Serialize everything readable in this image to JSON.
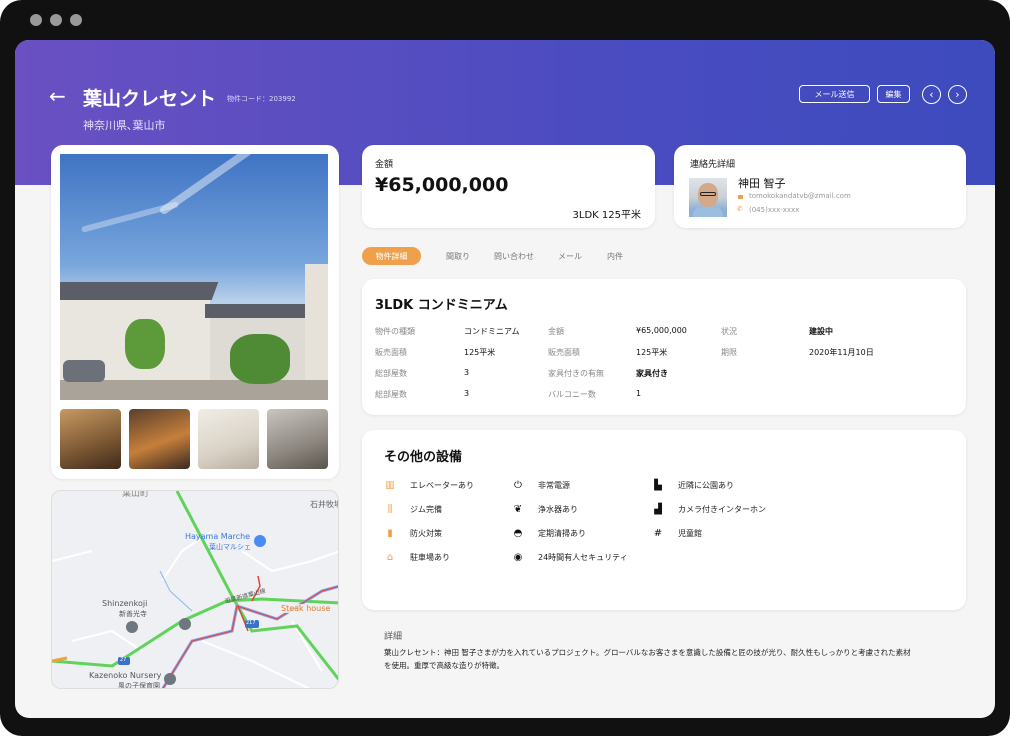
{
  "header": {
    "title": "葉山クレセント",
    "code": "物件コード：203992",
    "location": "神奈川県､葉山市",
    "mail_button": "メール送信",
    "edit_button": "編集"
  },
  "price_card": {
    "label": "金額",
    "price": "¥65,000,000",
    "summary": "3LDK 125平米"
  },
  "contact": {
    "label": "連絡先詳細",
    "name": "神田 智子",
    "email": "tomokokandatvb@zmail.com",
    "phone": "(045)xxx-xxxx"
  },
  "tabs": [
    {
      "label": "物件詳細",
      "active": true
    },
    {
      "label": "間取り"
    },
    {
      "label": "問い合わせ"
    },
    {
      "label": "メール"
    },
    {
      "label": "内件"
    }
  ],
  "details": {
    "title": "3LDK コンドミニアム",
    "rows": [
      [
        {
          "k": "物件の種類",
          "v": "コンドミニアム"
        },
        {
          "k": "金額",
          "v": "¥65,000,000"
        },
        {
          "k": "状況",
          "v": "建設中"
        }
      ],
      [
        {
          "k": "販売面積",
          "v": "125平米"
        },
        {
          "k": "販売面積",
          "v": "125平米"
        },
        {
          "k": "期限",
          "v": "2020年11月10日"
        }
      ],
      [
        {
          "k": "総部屋数",
          "v": "3"
        },
        {
          "k": "家具付きの有無",
          "v": "家具付き"
        }
      ],
      [
        {
          "k": "総部屋数",
          "v": "3"
        },
        {
          "k": "バルコニー数",
          "v": "1"
        }
      ]
    ]
  },
  "facilities": {
    "title": "その他の設備",
    "items": [
      {
        "label": "エレベーターあり",
        "icon": "elevator-icon",
        "color": "#f0a04b"
      },
      {
        "label": "非常電源",
        "icon": "plug-icon",
        "color": "#111111"
      },
      {
        "label": "近隣に公園あり",
        "icon": "park-bench-icon",
        "color": "#111111"
      },
      {
        "label": "ジム完備",
        "icon": "dumbbell-icon",
        "color": "#f0a04b"
      },
      {
        "label": "浄水器あり",
        "icon": "plant-icon",
        "color": "#111111"
      },
      {
        "label": "カメラ付きインターホン",
        "icon": "signal-icon",
        "color": "#111111"
      },
      {
        "label": "防火対策",
        "icon": "fire-extinguisher-icon",
        "color": "#f0a04b"
      },
      {
        "label": "定期清掃あり",
        "icon": "cleaning-bell-icon",
        "color": "#111111"
      },
      {
        "label": "児童館",
        "icon": "fence-icon",
        "color": "#111111"
      },
      {
        "label": "駐車場あり",
        "icon": "garage-icon",
        "color": "#f0a04b"
      },
      {
        "label": "24時間有人セキュリティ",
        "icon": "security-camera-icon",
        "color": "#111111"
      }
    ]
  },
  "description": {
    "label": "詳細",
    "text": "葉山クレセント：神田 智子さまが力を入れているプロジェクト。グローバルなお客さまを意識した設備と匠の技が光り、耐久性もしっかりと考慮された素材を使用。重厚で高級な造りが特徴。"
  },
  "map": {
    "labels": [
      "葉山町",
      "石井牧場",
      "Hayama Marche",
      "葉山マルシェ",
      "Shinzenkoji",
      "新善光寺",
      "Kazenoko Nursery",
      "風の子保育園",
      "Steak house",
      "逗葉新道葉山線",
      "217",
      "27"
    ]
  },
  "colors": {
    "accent": "#f0a04b",
    "header_start": "#6a50c2",
    "header_end": "#3d4bbd"
  }
}
